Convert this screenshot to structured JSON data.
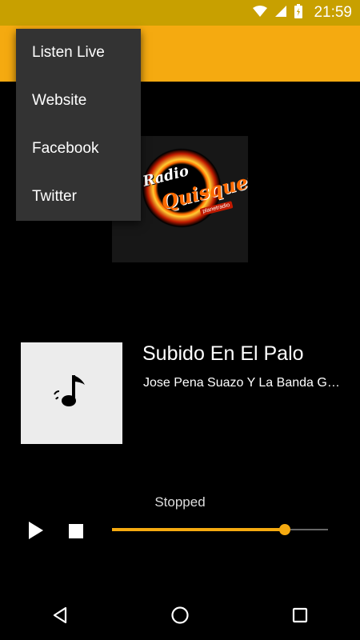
{
  "status_bar": {
    "time": "21:59"
  },
  "menu": {
    "items": [
      {
        "label": "Listen Live"
      },
      {
        "label": "Website"
      },
      {
        "label": "Facebook"
      },
      {
        "label": "Twitter"
      }
    ]
  },
  "logo": {
    "line1": "Radio",
    "line2": "Quisqueya",
    "url": "planetradio"
  },
  "now_playing": {
    "title": "Subido En El Palo",
    "artist": "Jose Pena Suazo Y La Banda Gorda",
    "state": "Stopped",
    "progress": 0.8
  },
  "colors": {
    "accent": "#F5AA10",
    "status_bar": "#C8A000",
    "menu_bg": "#333333"
  },
  "icons": [
    "wifi-icon",
    "signal-icon",
    "battery-icon",
    "music-note-icon",
    "play-icon",
    "stop-icon",
    "back-icon",
    "home-icon",
    "recents-icon"
  ]
}
